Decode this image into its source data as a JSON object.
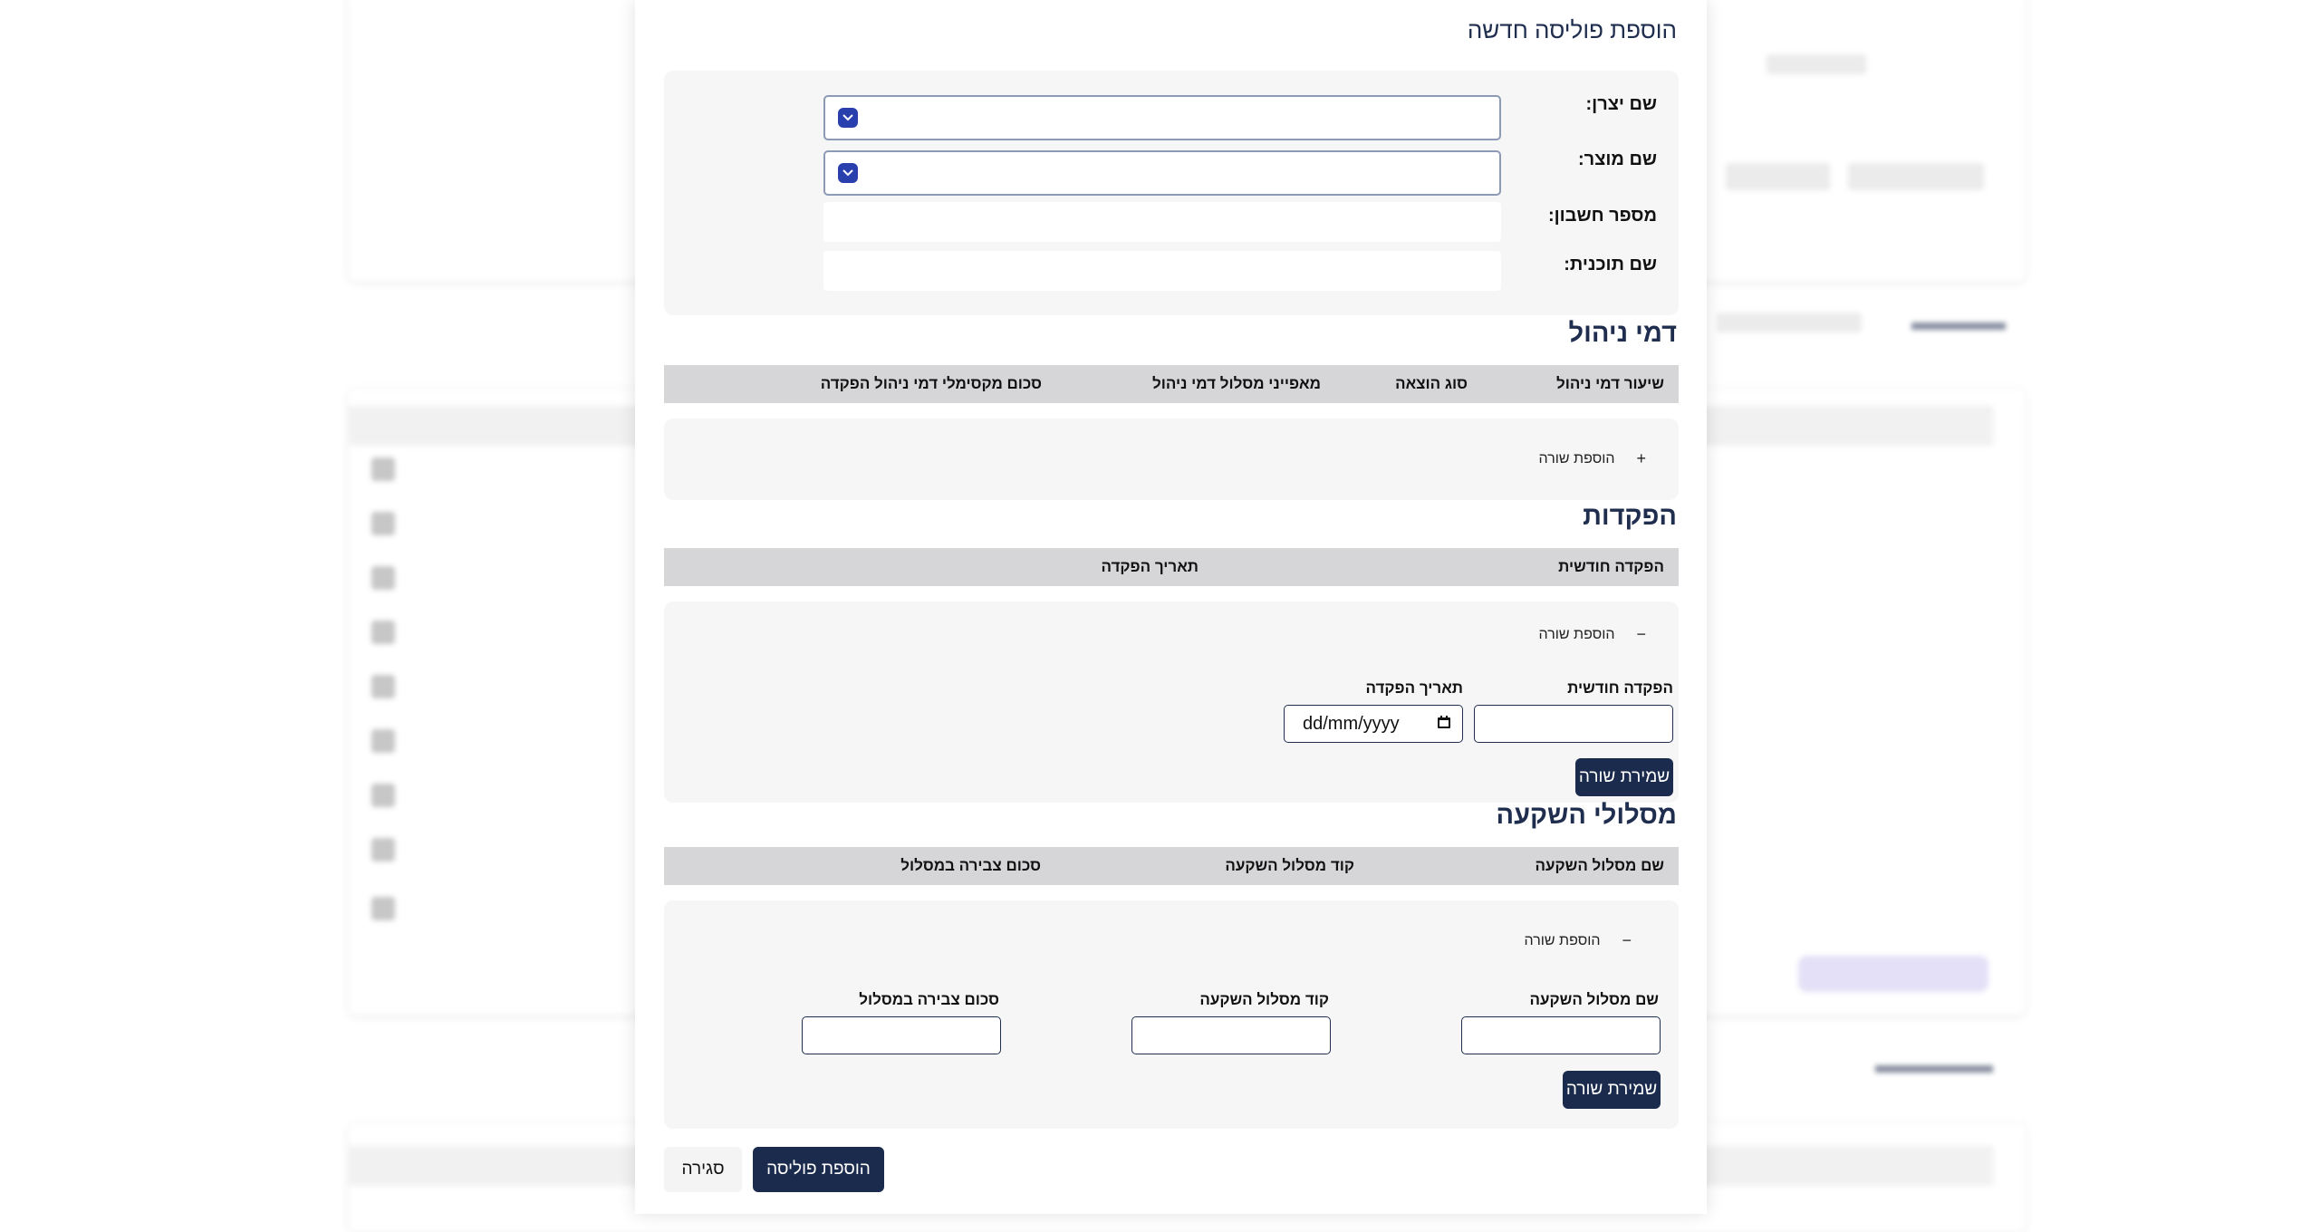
{
  "modal": {
    "title": "הוספת פוליסה חדשה",
    "fields": {
      "manufacturer_label": "שם יצרן:",
      "product_label": "שם מוצר:",
      "account_label": "מספר חשבון:",
      "plan_label": "שם תוכנית:"
    },
    "management_fees": {
      "title": "דמי ניהול",
      "columns": [
        "שיעור דמי ניהול",
        "סוג הוצאה",
        "מאפייני מסלול דמי ניהול",
        "סכום מקסימלי דמי ניהול הפקדה"
      ],
      "add_row_label": "הוספת שורה",
      "add_row_sign": "+"
    },
    "deposits": {
      "title": "הפקדות",
      "columns": [
        "הפקדה חודשית",
        "תאריך הפקדה"
      ],
      "add_row_label": "הוספת שורה",
      "add_row_sign": "−",
      "monthly_label": "הפקדה חודשית",
      "date_label": "תאריך הפקדה",
      "date_placeholder": "dd/mm/yyyy",
      "save_label": "שמירת שורה"
    },
    "investment_tracks": {
      "title": "מסלולי השקעה",
      "columns": [
        "שם מסלול השקעה",
        "קוד מסלול השקעה",
        "סכום צבירה במסלול"
      ],
      "add_row_label": "הוספת שורה",
      "add_row_sign": "−",
      "name_label": "שם מסלול השקעה",
      "code_label": "קוד מסלול השקעה",
      "amount_label": "סכום צבירה במסלול",
      "save_label": "שמירת שורה"
    },
    "footer": {
      "submit_label": "הוספת פוליסה",
      "close_label": "סגירה"
    }
  },
  "colors": {
    "navy": "#1b2b4d",
    "title_navy": "#1f2d4e",
    "panel": "#f6f6f7",
    "table_head": "#d6d6d8"
  }
}
